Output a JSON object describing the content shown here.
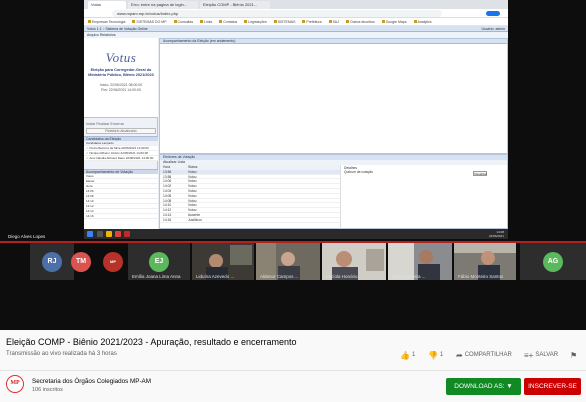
{
  "browser": {
    "tabs": [
      "Votus",
      "Erro: entre na pagina de login...",
      "Eleição COMP - Biênio 2021..."
    ],
    "url": "www.mpam.mp.br/votus/index.php",
    "bookmarks": [
      "Empresas Tecnologia",
      "SISTEMAS DO MP",
      "Consultas",
      "Links",
      "Contatos",
      "Legislações",
      "SISTEMAS",
      "Prefeitura",
      "SAJ",
      "Outros favoritos",
      "Google Maps",
      "Analytics"
    ]
  },
  "votus_app": {
    "header": "Votus 1.1 :: Sistema de Votação Online",
    "menu": "Arquivo   Relatórios",
    "user_info": "Usuário: admin",
    "logo": "Votus",
    "subtitle": "Eleição para Corregedor-Geral do Ministério Público, Biênio 2021/2023",
    "dates": [
      "Início: 22/06/2021 08:00:00",
      "Fim: 22/06/2021 14:00:00"
    ],
    "panel_buttons": "Iniciar   Finalizar   Encerrar",
    "report_button": "Relatório Atualizado",
    "candidates_title": "Candidatos da Eleição",
    "candidates_header": "Candidatos          Lançado",
    "candidates": [
      "Pedro Bezerra da Silva   22/06/2021 14:00:00",
      "Nicolau Ribeiro Libório   22/06/2021 14:00:00",
      "Ana Cláudia Abboud Daou   22/06/2021 14:00:00"
    ],
    "main_title": "Acompanhamento da Eleição (em andamento)",
    "votes_title": "Acompanhamento de Votação",
    "votes_filter": "Votos",
    "voter_title": "Eleitores da Votação",
    "voter_tools": "Atualizar Lista",
    "voter_list_left": [
      "Eleitor",
      "Hora",
      "14:06",
      "14:08",
      "14:10",
      "14:12",
      "14:14",
      "14:16"
    ],
    "voter_header": [
      "Hora",
      "Status"
    ],
    "voter_rows": [
      [
        "13:56",
        "Votou"
      ],
      [
        "13:58",
        "Votou"
      ],
      [
        "14:00",
        "Votou"
      ],
      [
        "14:02",
        "Votou"
      ],
      [
        "14:04",
        "Votou"
      ],
      [
        "14:06",
        "Votou"
      ],
      [
        "14:08",
        "Votou"
      ],
      [
        "14:10",
        "Votou"
      ],
      [
        "14:12",
        "Votou"
      ],
      [
        "14:14",
        "Ausente"
      ],
      [
        "14:16",
        "Justificou"
      ]
    ],
    "detail_label": "Detalhes",
    "detail_text": "Quórum da votação",
    "detail_button": "Visualizar",
    "clock": [
      "14:08",
      "22/06/2021"
    ]
  },
  "presenter_name": "Diego Alves Lopes",
  "participants": [
    {
      "initials": "RJ",
      "name": "",
      "color": "#4c6fa8"
    },
    {
      "initials": "TM",
      "name": "",
      "color": "#d9534f"
    },
    {
      "initials": "",
      "name": "",
      "color": "#b8322a"
    },
    {
      "initials": "EJ",
      "name": "Emília Joana Lima Anna",
      "color": "#5cb85c"
    },
    {
      "initials": "",
      "name": "Liduína Azevedo ...",
      "color": ""
    },
    {
      "initials": "",
      "name": "Aldenor Campos ...",
      "color": ""
    },
    {
      "initials": "",
      "name": "Lucíola Honório ...",
      "color": ""
    },
    {
      "initials": "",
      "name": "Alda Nogueira ...",
      "color": ""
    },
    {
      "initials": "",
      "name": "Fábio Monteiro Santos",
      "color": ""
    },
    {
      "initials": "AG",
      "name": "",
      "color": "#5cb85c"
    }
  ],
  "video": {
    "title": "Eleição COMP - Biênio 2021/2023 - Apuração, resultado e encerramento",
    "subline": "Transmissão ao vivo realizada há 3 horas"
  },
  "actions": {
    "like_count": "1",
    "dislike_count": "1",
    "share_label": "COMPARTILHAR",
    "save_label": "SALVAR"
  },
  "channel": {
    "name": "Secretaria dos Órgãos Colegiados MP-AM",
    "subscribers": "106 inscritos"
  },
  "buttons": {
    "download_label": "DOWNLOAD AS: ▼",
    "subscribe_label": "INSCREVER-SE"
  }
}
